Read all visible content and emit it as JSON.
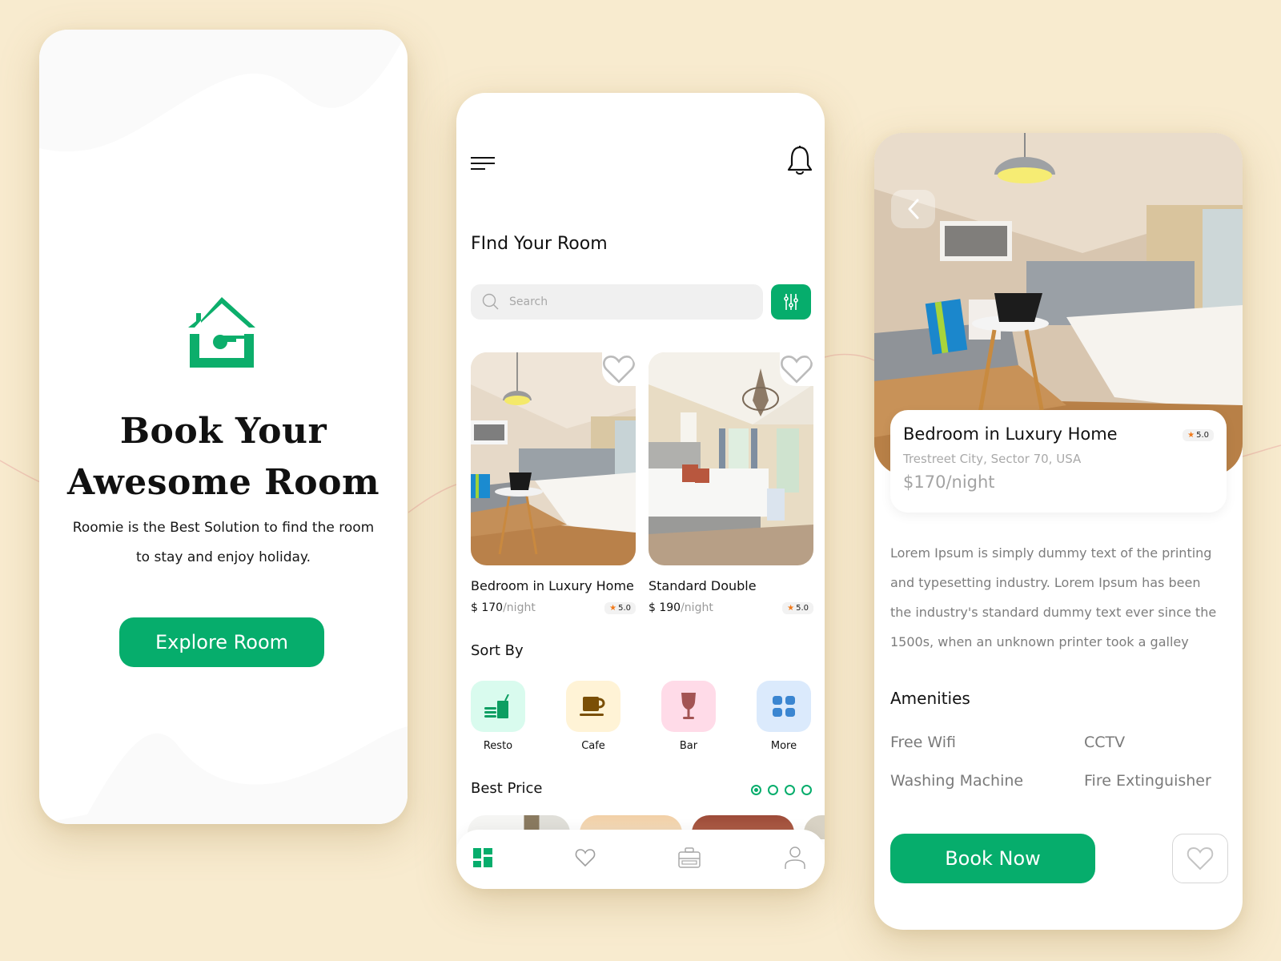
{
  "theme": {
    "accent": "#06ad6c",
    "background": "#f8ebcf",
    "star": "#f27a1a"
  },
  "splash": {
    "logo_icon": "house-key-logo-icon",
    "title_line1": "Book Your",
    "title_line2": "Awesome Room",
    "subtitle_line1": "Roomie is the Best Solution to find the room",
    "subtitle_line2": "to stay and enjoy holiday.",
    "cta_label": "Explore Room"
  },
  "finder": {
    "menu_icon": "hamburger-menu-icon",
    "notification_icon": "bell-icon",
    "title": "FInd Your Room",
    "search": {
      "placeholder": "Search",
      "value": ""
    },
    "filter_icon": "sliders-icon",
    "rooms": [
      {
        "name": "Bedroom in Luxury Home",
        "price": "$ 170",
        "per": "/night",
        "rating": "5.0"
      },
      {
        "name": "Standard Double",
        "price": "$ 190",
        "per": "/night",
        "rating": "5.0"
      }
    ],
    "sort_by_label": "Sort By",
    "sort_options": [
      {
        "label": "Resto",
        "icon": "food-drink-icon",
        "tile_color": "#d9fbee",
        "icon_color": "#0d9e62"
      },
      {
        "label": "Cafe",
        "icon": "coffee-cup-icon",
        "tile_color": "#fff3d6",
        "icon_color": "#7a4f06"
      },
      {
        "label": "Bar",
        "icon": "wine-glass-icon",
        "tile_color": "#ffdbe8",
        "icon_color": "#a35454"
      },
      {
        "label": "More",
        "icon": "grid-icon",
        "tile_color": "#dbeafc",
        "icon_color": "#3b86d1"
      }
    ],
    "best_price_label": "Best Price",
    "pagination": {
      "total": 4,
      "active": 1
    },
    "tabs": [
      {
        "name": "home",
        "icon": "dashboard-icon",
        "active": true
      },
      {
        "name": "favorites",
        "icon": "heart-icon",
        "active": false
      },
      {
        "name": "bookings",
        "icon": "briefcase-icon",
        "active": false
      },
      {
        "name": "profile",
        "icon": "user-icon",
        "active": false
      }
    ]
  },
  "detail": {
    "back_icon": "chevron-left-icon",
    "name": "Bedroom in Luxury Home",
    "rating": "5.0",
    "location": "Trestreet City, Sector 70, USA",
    "price": "$170/night",
    "description_lines": [
      "Lorem Ipsum is simply dummy text of the printing",
      "and typesetting industry. Lorem Ipsum has been",
      "the industry's standard dummy text ever since the",
      "1500s, when an unknown printer took a galley"
    ],
    "amenities_title": "Amenities",
    "amenities": [
      "Free Wifi",
      "CCTV",
      "Washing Machine",
      "Fire Extinguisher"
    ],
    "book_label": "Book Now",
    "favorite_icon": "heart-icon"
  }
}
